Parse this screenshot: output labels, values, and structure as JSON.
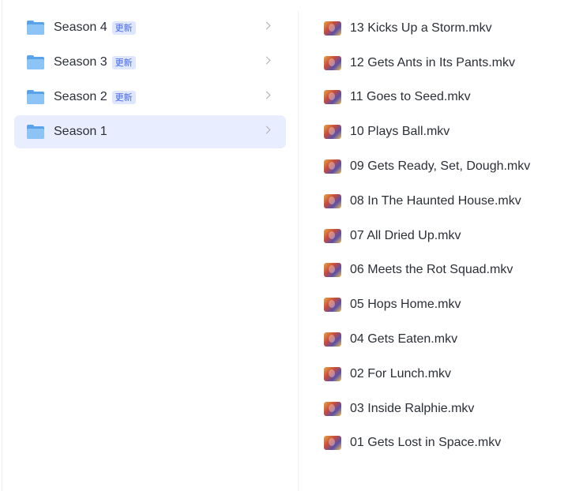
{
  "folders": [
    {
      "name": "Season 4",
      "badge": "更新",
      "selected": false
    },
    {
      "name": "Season 3",
      "badge": "更新",
      "selected": false
    },
    {
      "name": "Season 2",
      "badge": "更新",
      "selected": false
    },
    {
      "name": "Season 1",
      "badge": "",
      "selected": true
    }
  ],
  "files": [
    {
      "name": "13 Kicks Up a Storm.mkv"
    },
    {
      "name": "12 Gets Ants in Its Pants.mkv"
    },
    {
      "name": "11 Goes to Seed.mkv"
    },
    {
      "name": "10 Plays Ball.mkv"
    },
    {
      "name": "09 Gets Ready, Set, Dough.mkv"
    },
    {
      "name": "08 In The Haunted House.mkv"
    },
    {
      "name": "07 All Dried Up.mkv"
    },
    {
      "name": "06 Meets the Rot Squad.mkv"
    },
    {
      "name": "05 Hops Home.mkv"
    },
    {
      "name": "04 Gets Eaten.mkv"
    },
    {
      "name": "02 For Lunch.mkv"
    },
    {
      "name": "03 Inside Ralphie.mkv"
    },
    {
      "name": "01 Gets Lost in Space.mkv"
    }
  ],
  "icons": {
    "folder": "folder-icon",
    "chevron": "chevron-right-icon",
    "video_thumbnail": "video-thumbnail-icon"
  },
  "colors": {
    "selected_background": "#e8eeff",
    "badge_text": "#4466ee",
    "badge_background": "#dfe7ff",
    "folder_blue": "#5aa2ea"
  }
}
